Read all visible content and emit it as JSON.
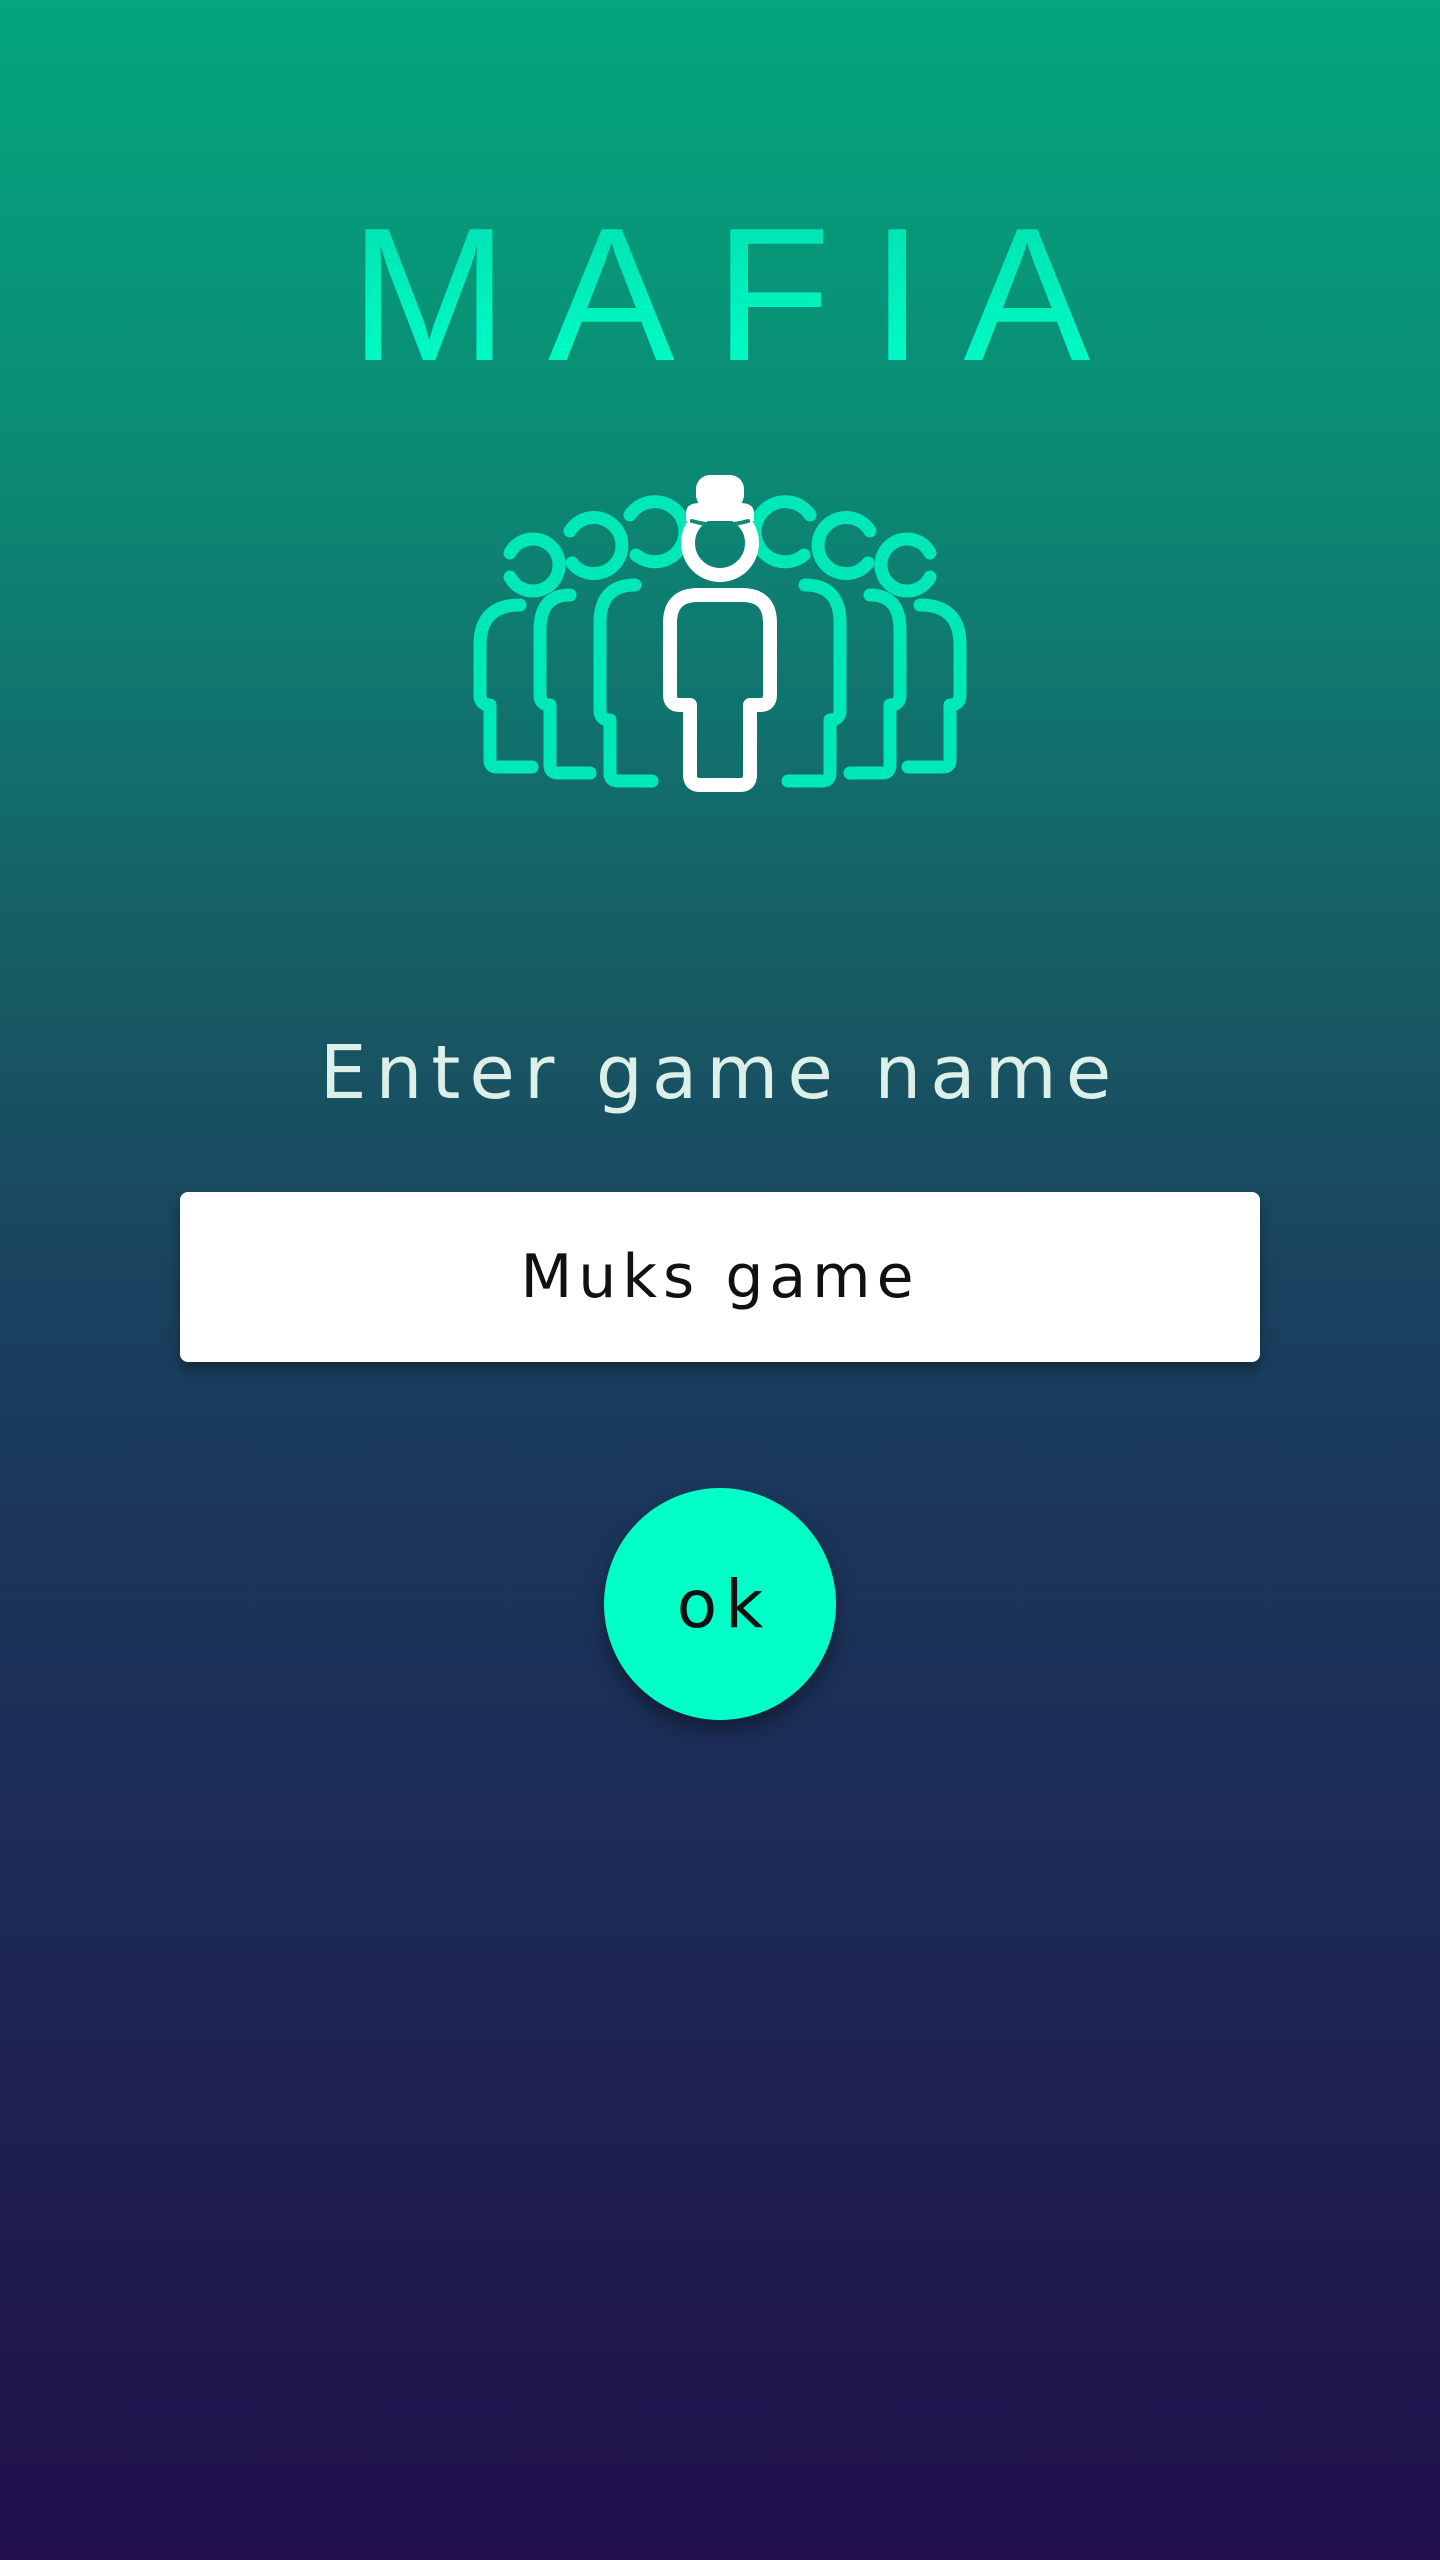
{
  "app": {
    "title": "MAFIA",
    "logo_icon": "mafia-crowd-icon"
  },
  "form": {
    "prompt": "Enter game name",
    "game_name_value": "Muks game",
    "ok_label": "ok"
  },
  "colors": {
    "accent": "#00ffc6",
    "gradient_top": "#03a67e",
    "gradient_bottom": "#21104c",
    "input_background": "#ffffff"
  }
}
